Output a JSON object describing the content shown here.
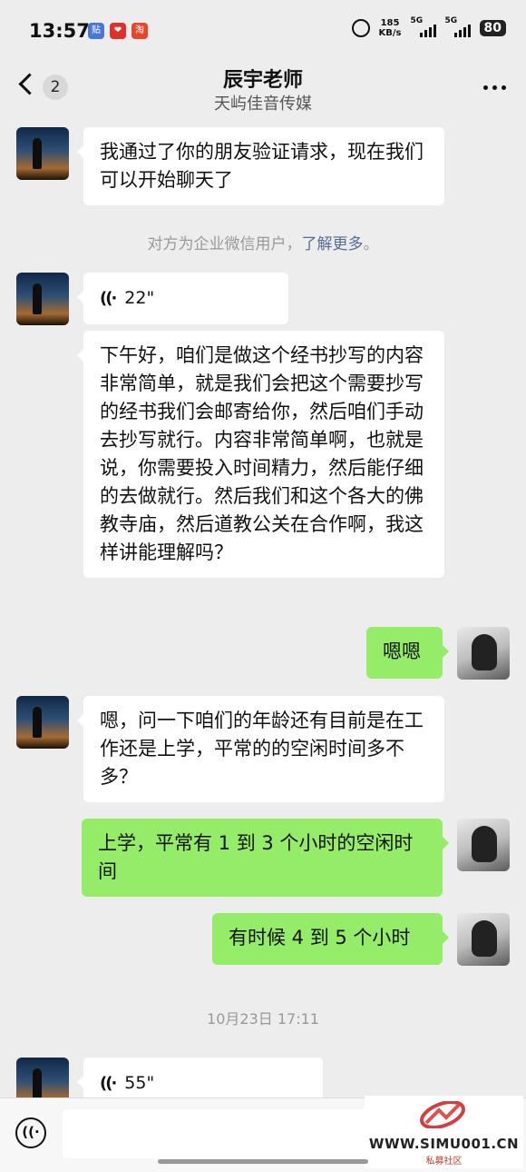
{
  "status_bar": {
    "time": "13:57",
    "net_speed_value": "185",
    "net_speed_unit": "KB/s",
    "signal1_label": "5G",
    "signal2_label": "5G",
    "battery": "80"
  },
  "header": {
    "unread_count": "2",
    "title": "辰宇老师",
    "subtitle": "天屿佳音传媒"
  },
  "messages": [
    {
      "from": "teacher",
      "text": "我通过了你的朋友验证请求，现在我们可以开始聊天了"
    },
    {
      "system": true,
      "text": "对方为企业微信用户，",
      "link": "了解更多",
      "suffix": "。"
    },
    {
      "from": "teacher",
      "type": "voice",
      "duration": "22\""
    },
    {
      "from": "teacher",
      "text": "下午好，咱们是做这个经书抄写的内容非常简单，就是我们会把这个需要抄写的经书我们会邮寄给你，然后咱们手动去抄写就行。内容非常简单啊，也就是说，你需要投入时间精力，然后能仔细的去做就行。然后我们和这个各大的佛教寺庙，然后道教公关在合作啊，我这样讲能理解吗？"
    },
    {
      "from": "me",
      "text": "嗯嗯"
    },
    {
      "from": "teacher",
      "text": "嗯，问一下咱们的年龄还有目前是在工作还是上学，平常的的空闲时间多不多？"
    },
    {
      "from": "me",
      "text": "上学，平常有 1 到 3 个小时的空闲时间"
    },
    {
      "from": "me",
      "text": "有时候 4 到 5 个小时"
    },
    {
      "system": true,
      "text": "10月23日 17:11"
    },
    {
      "from": "teacher",
      "type": "voice",
      "duration": "55\""
    }
  ],
  "icons": {
    "voice_wave": "((·",
    "voice_toggle": "voice-toggle-icon"
  },
  "watermark": {
    "url": "WWW.SIMU001.CN",
    "sub": "私募社区",
    "color": "#c0392b"
  },
  "colors": {
    "outgoing_bubble": "#95ec69",
    "incoming_bubble": "#ffffff",
    "link": "#576b95"
  }
}
